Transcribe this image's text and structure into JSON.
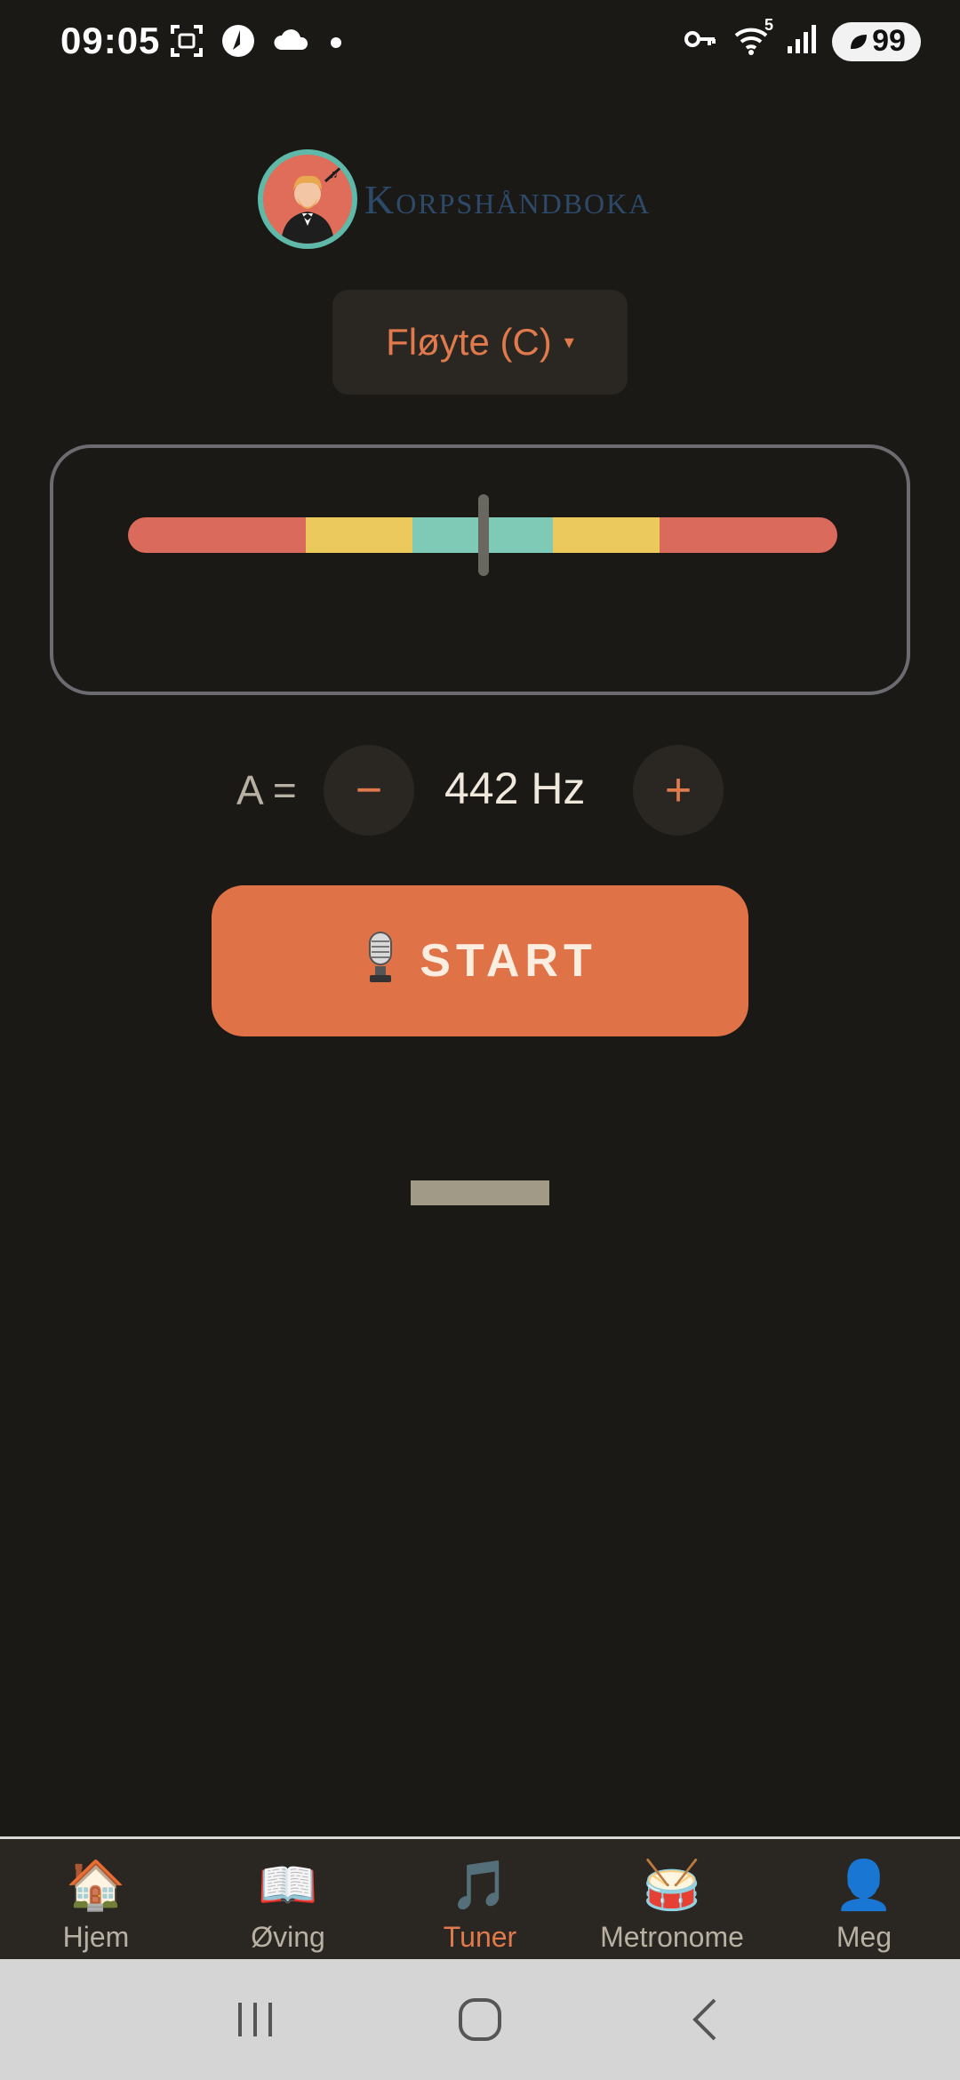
{
  "status_bar": {
    "time": "09:05",
    "battery": "99",
    "network_badge": "5",
    "icons_left": [
      "screenshot-icon",
      "location-icon",
      "cloud-icon",
      "dot-icon"
    ],
    "icons_right": [
      "vpn-key-icon",
      "wifi-icon",
      "signal-icon",
      "battery-icon"
    ]
  },
  "header": {
    "logo_text": "Korpshåndboka"
  },
  "instrument": {
    "label": "Fløyte (C)",
    "caret": "▾"
  },
  "meter": {
    "needle_position": 0.5,
    "zones": [
      "red",
      "yellow",
      "green",
      "yellow",
      "red"
    ]
  },
  "reference_pitch": {
    "label": "A =",
    "value": "442 Hz",
    "minus": "−",
    "plus": "+"
  },
  "start_button": {
    "icon": "🎙️",
    "label": "START"
  },
  "bottom_nav": {
    "items": [
      {
        "icon": "🏠",
        "label": "Hjem",
        "active": false
      },
      {
        "icon": "📖",
        "label": "Øving",
        "active": false
      },
      {
        "icon": "🎵",
        "label": "Tuner",
        "active": true
      },
      {
        "icon": "🥁",
        "label": "Metronome",
        "active": false
      },
      {
        "icon": "👤",
        "label": "Meg",
        "active": false
      }
    ]
  },
  "colors": {
    "background": "#1a1916",
    "accent": "#e07248",
    "meter_red": "#d96a5c",
    "meter_yellow": "#ecc95c",
    "meter_green": "#7ecab6"
  }
}
